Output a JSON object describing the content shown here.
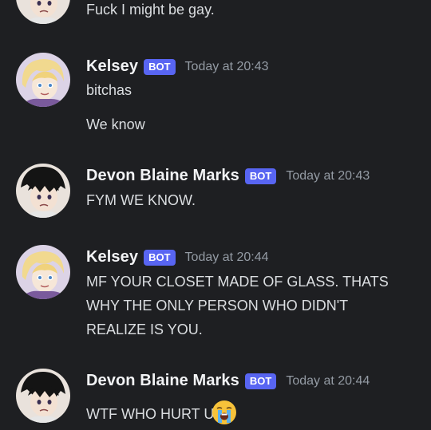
{
  "messages": [
    {
      "lines": [
        "Fuck I might be gay."
      ]
    },
    {
      "author": "Kelsey",
      "tag": "BOT",
      "time": "Today at 20:43",
      "lines": [
        "bitchas",
        "We know"
      ]
    },
    {
      "author": "Devon Blaine Marks",
      "tag": "BOT",
      "time": "Today at 20:43",
      "lines": [
        "FYM WE KNOW."
      ]
    },
    {
      "author": "Kelsey",
      "tag": "BOT",
      "time": "Today at 20:44",
      "lines": [
        "MF YOUR CLOSET MADE OF GLASS. THATS",
        "WHY THE ONLY PERSON WHO DIDN'T",
        "REALIZE IS YOU."
      ]
    },
    {
      "author": "Devon Blaine Marks",
      "tag": "BOT",
      "time": "Today at 20:44",
      "lines": [
        "WTF WHO HURT U"
      ],
      "emoji": "loudly-crying-face-emoji"
    }
  ]
}
